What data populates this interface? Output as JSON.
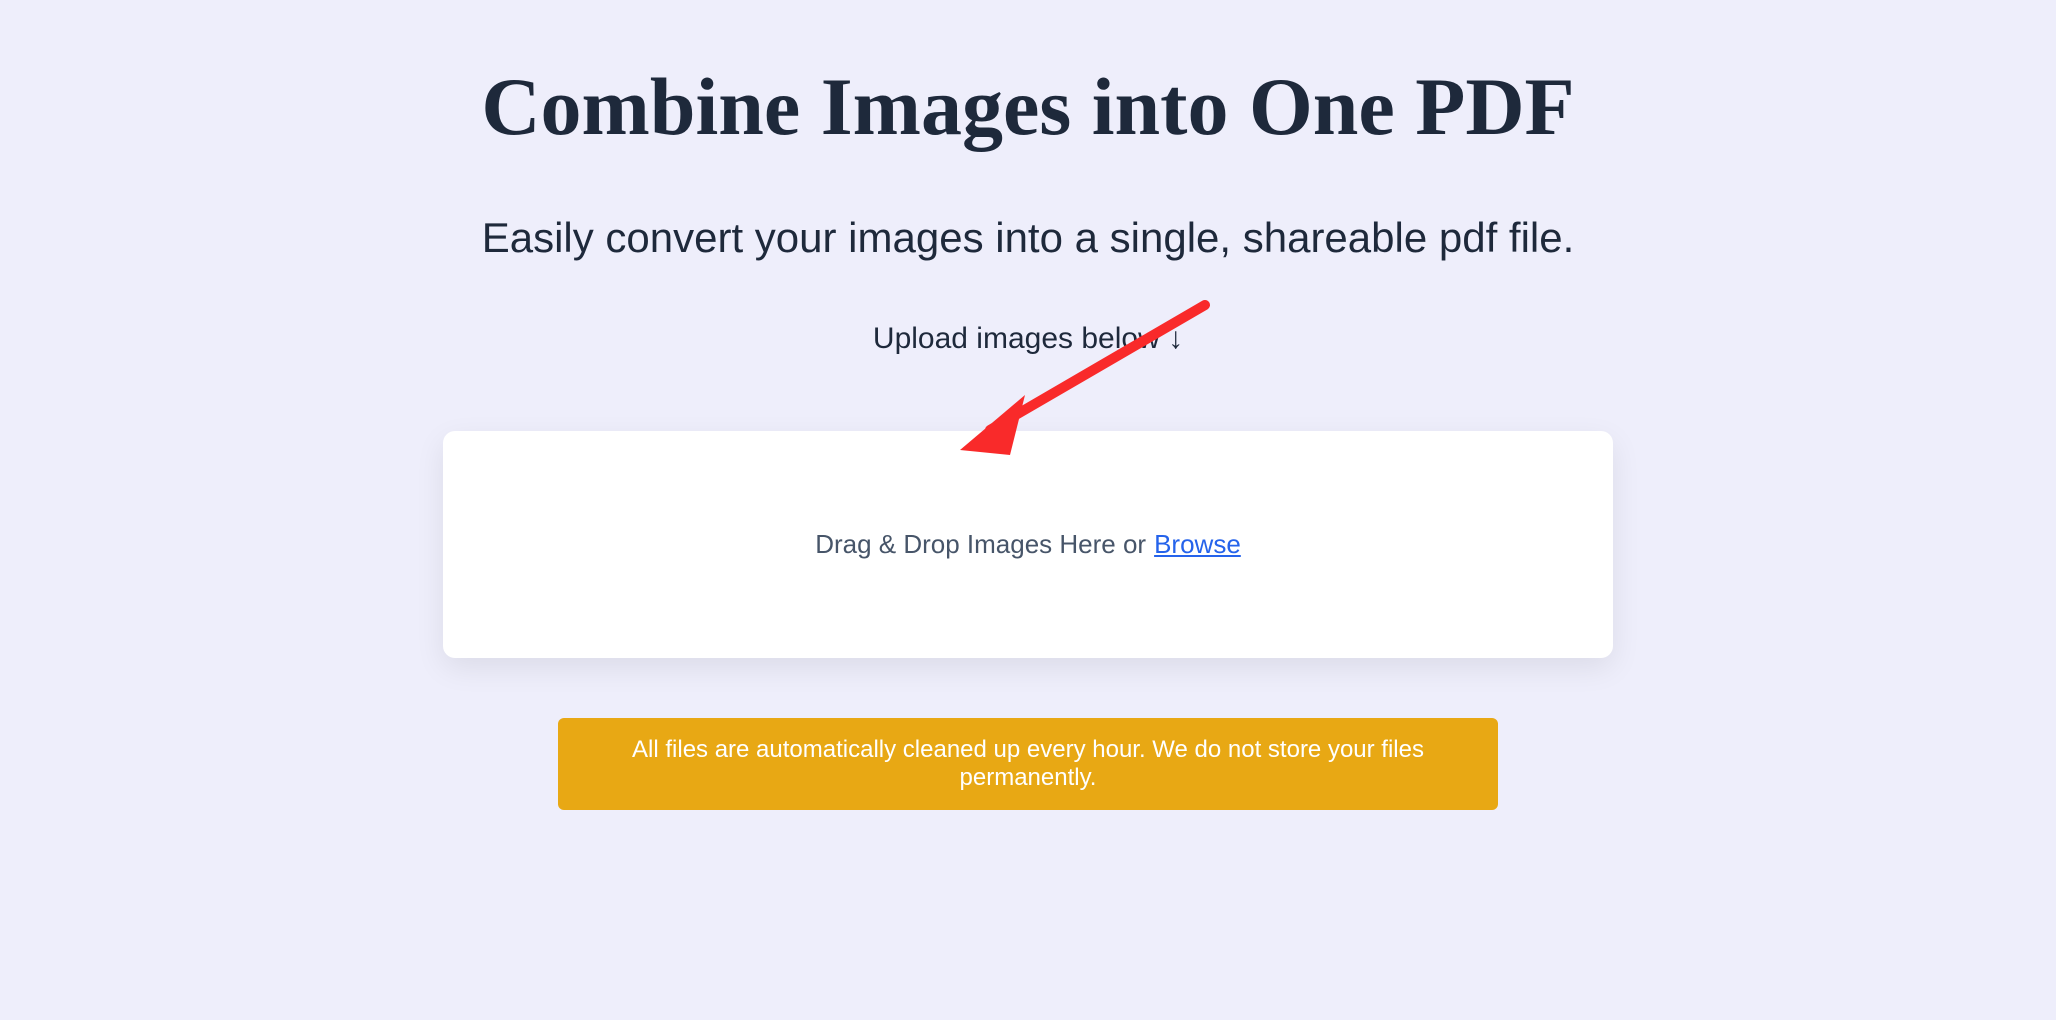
{
  "header": {
    "title": "Combine Images into One PDF",
    "subtitle": "Easily convert your images into a single, shareable pdf file.",
    "upload_hint": "Upload images below ↓"
  },
  "dropzone": {
    "text": "Drag & Drop Images Here or ",
    "browse_label": "Browse"
  },
  "notice": {
    "text": "All files are automatically cleaned up every hour. We do not store your files permanently."
  },
  "colors": {
    "background": "#eeeefb",
    "text_dark": "#1e293b",
    "text_muted": "#475569",
    "link": "#2563eb",
    "banner": "#e8a814",
    "banner_text": "#ffffff",
    "card": "#ffffff",
    "arrow": "#f92a2a"
  }
}
